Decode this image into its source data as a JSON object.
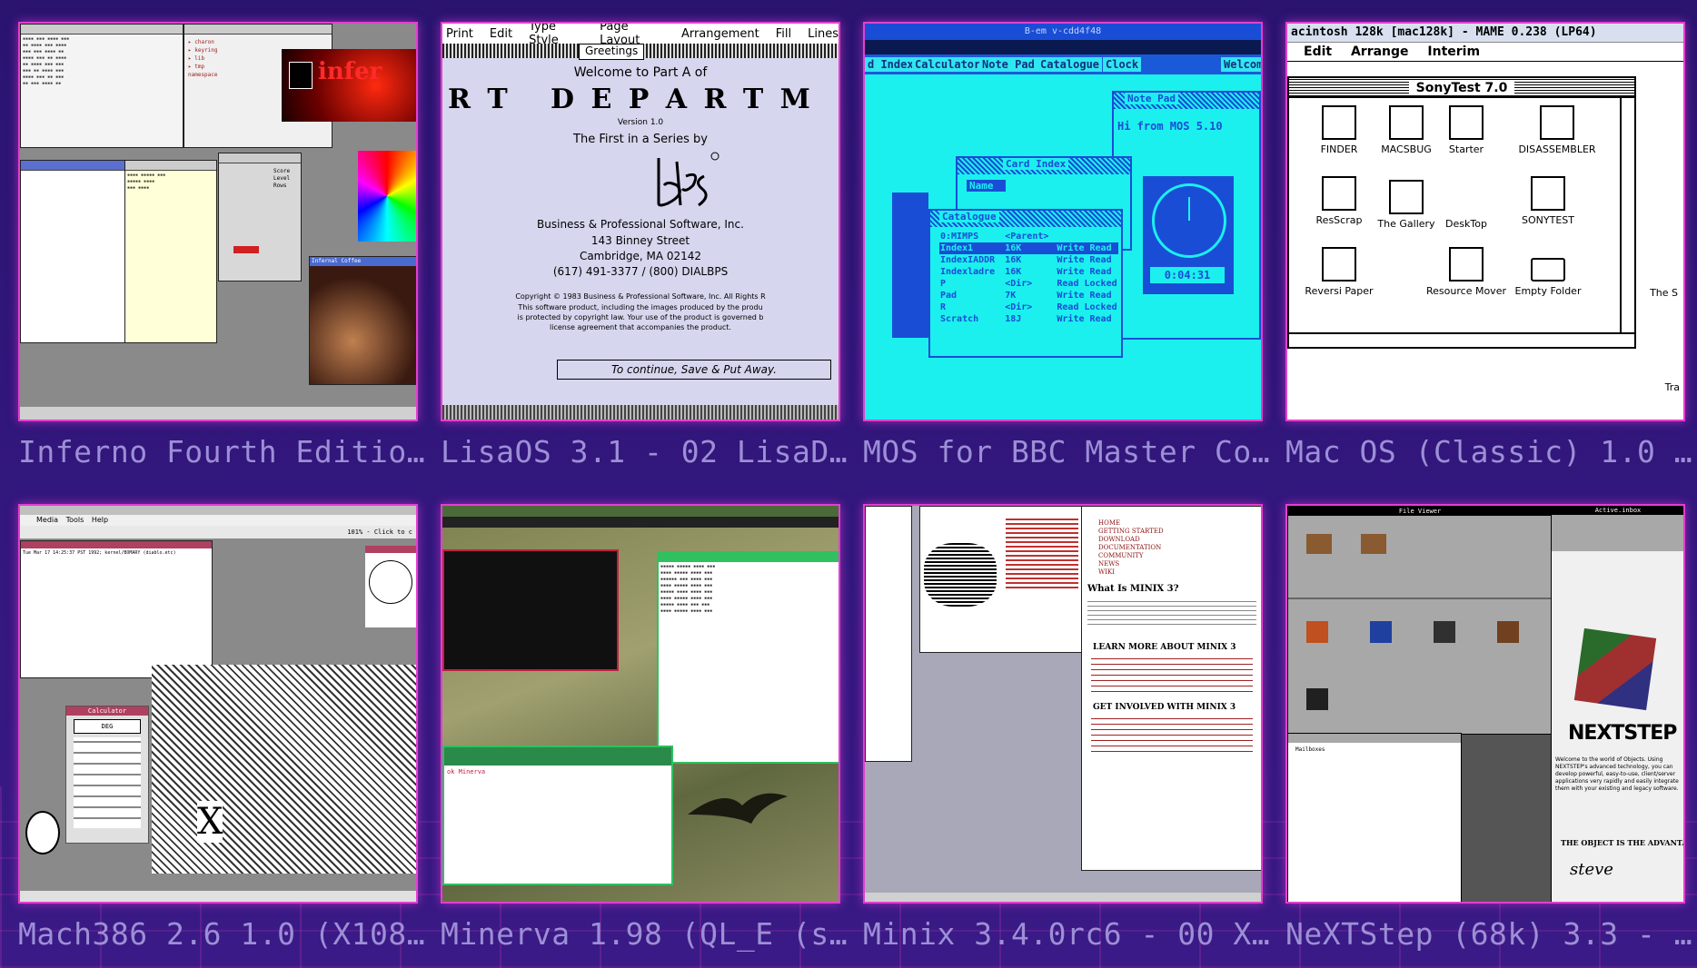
{
  "tiles": [
    {
      "caption": "Inferno Fourth Editio…"
    },
    {
      "caption": "LisaOS 3.1 - 02 LisaD…"
    },
    {
      "caption": "MOS for BBC Master Co…"
    },
    {
      "caption": "Mac OS (Classic) 1.0 …"
    },
    {
      "caption": "Mach386 2.6 1.0 (X108…"
    },
    {
      "caption": "Minerva 1.98 (QL_E (s…"
    },
    {
      "caption": "Minix 3.4.0rc6 - 00 X…"
    },
    {
      "caption": "NeXTStep (68k) 3.3 - …"
    }
  ],
  "inferno": {
    "logo_text": "infer",
    "window_title": "Infernal Coffee",
    "labels": [
      "Score",
      "Level",
      "Rows"
    ]
  },
  "lisa": {
    "menu": [
      "Print",
      "Edit",
      "Type Style",
      "Page Layout",
      "Arrangement",
      "Fill",
      "Lines"
    ],
    "greetings": "Greetings",
    "welcome": "Welcome to Part A of",
    "big_title": "R T   D E P A R T M",
    "version": "Version 1.0",
    "series": "The First in a Series by",
    "company": "Business & Professional Software, Inc.",
    "street": "143 Binney Street",
    "city": "Cambridge, MA  02142",
    "phone": "(617) 491-3377 / (800) DIALBPS",
    "copyright": "Copyright © 1983 Business & Professional Software, Inc. All Rights R",
    "legal1": "This software product, including the images produced by the produ",
    "legal2": "is protected by copyright law. Your use of the product is governed b",
    "legal3": "license agreement that accompanies the product.",
    "continue": "To continue, Save & Put Away."
  },
  "mos": {
    "top_title": "B-em v-cdd4f48",
    "buttons": [
      "d Index",
      "Calculator",
      "Note Pad",
      "Catalogue",
      "Clock",
      "Welcome"
    ],
    "note_pad_title": "Note Pad",
    "hi_text": "Hi from MOS 5.10",
    "card_index_title": "Card Index",
    "name_label": "Name",
    "catalogue_title": "Catalogue",
    "clock_time": "0:04:31",
    "catalogue_rows": [
      [
        "0:MIMPS",
        "<Parent>",
        ""
      ],
      [
        "Index1",
        "16K",
        "Write Read"
      ],
      [
        "IndexIADDR",
        "16K",
        "Write Read"
      ],
      [
        "Indexladre",
        "16K",
        "Write Read"
      ],
      [
        "P",
        "<Dir>",
        "Read Locked"
      ],
      [
        "Pad",
        "7K",
        "Write Read"
      ],
      [
        "R",
        "<Dir>",
        "Read Locked"
      ],
      [
        "Scratch",
        "18J",
        "Write Read"
      ]
    ]
  },
  "mac": {
    "title": "acintosh 128k [mac128k] - MAME 0.238 (LP64)",
    "menu": [
      "Edit",
      "Arrange",
      "Interim"
    ],
    "window_title": "SonyTest 7.0",
    "icons": [
      "FINDER",
      "MACSBUG",
      "Starter",
      "DISASSEMBLER",
      "ResScrap",
      "The Gallery",
      "DeskTop",
      "SONYTEST",
      "Reversi Paper",
      "Resource Mover",
      "Empty Folder"
    ],
    "side_label": "The S",
    "trash_label": "Tra"
  },
  "mach": {
    "menu": [
      "Media",
      "Tools",
      "Help"
    ],
    "zoom": "101% - Click to c",
    "calc_title": "Calculator",
    "calc_display": "DEG",
    "term_line": "Tue Mar 17 14:25:37 PST 1992; kernel/BOMARY (diablo.etc)",
    "x_mark": "X"
  },
  "minerva": {
    "term_text": "ok Minerva"
  },
  "minix": {
    "nav": [
      "HOME",
      "GETTING STARTED",
      "DOWNLOAD",
      "DOCUMENTATION",
      "COMMUNITY",
      "NEWS",
      "WIKI"
    ],
    "h1": "What Is MINIX 3?",
    "h2": "LEARN MORE ABOUT MINIX 3",
    "h3": "GET INVOLVED WITH MINIX 3"
  },
  "next": {
    "file_viewer": "File Viewer",
    "active_inbox": "Active.inbox",
    "logo": "NEXTSTEP",
    "welcome": "Welcome to the world of Objects. Using NEXTSTEP's advanced technology, you can develop powerful, easy-to-use, client/server applications very rapidly and easily integrate them with your existing and legacy software.",
    "tagline": "THE OBJECT IS THE ADVANTAG",
    "signature": "steve",
    "mailbox": "Mailboxes"
  },
  "colors": {
    "accent_border": "#e33fd0",
    "caption": "#9c8fd6",
    "background": "#33177e"
  }
}
